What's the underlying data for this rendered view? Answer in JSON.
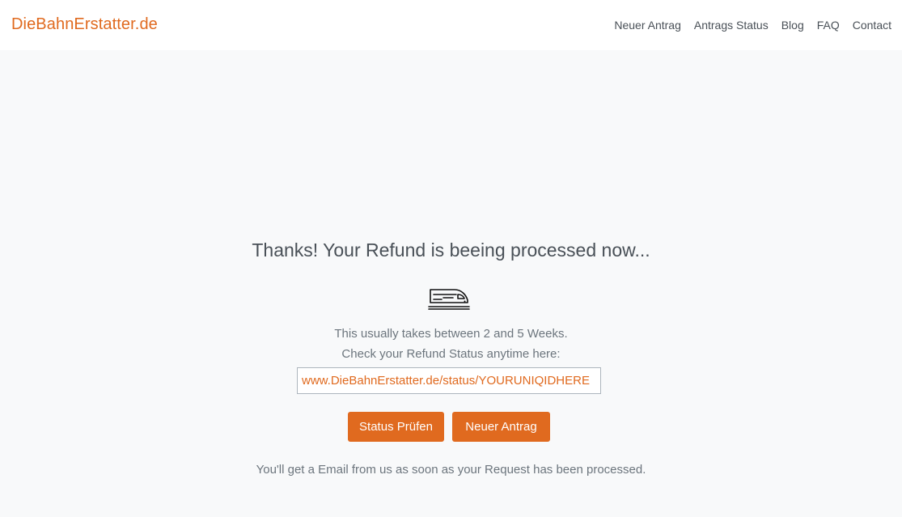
{
  "brand": "DieBahnErstatter.de",
  "nav": {
    "items": [
      "Neuer Antrag",
      "Antrags Status",
      "Blog",
      "FAQ",
      "Contact"
    ]
  },
  "main": {
    "headline": "Thanks! Your Refund is beeing processed now...",
    "icon": "train-icon",
    "info_line1": "This usually takes between 2 and 5 Weeks.",
    "info_line2": "Check your Refund Status anytime here:",
    "status_url": "www.DieBahnErstatter.de/status/YOURUNIQIDHERE",
    "buttons": {
      "status": "Status Prüfen",
      "new": "Neuer Antrag"
    },
    "footer_note": "You'll get a Email from us as soon as your Request has been processed."
  },
  "colors": {
    "accent": "#e06a1f",
    "background": "#f8f9fa",
    "text": "#495057",
    "muted": "#6c757d"
  }
}
